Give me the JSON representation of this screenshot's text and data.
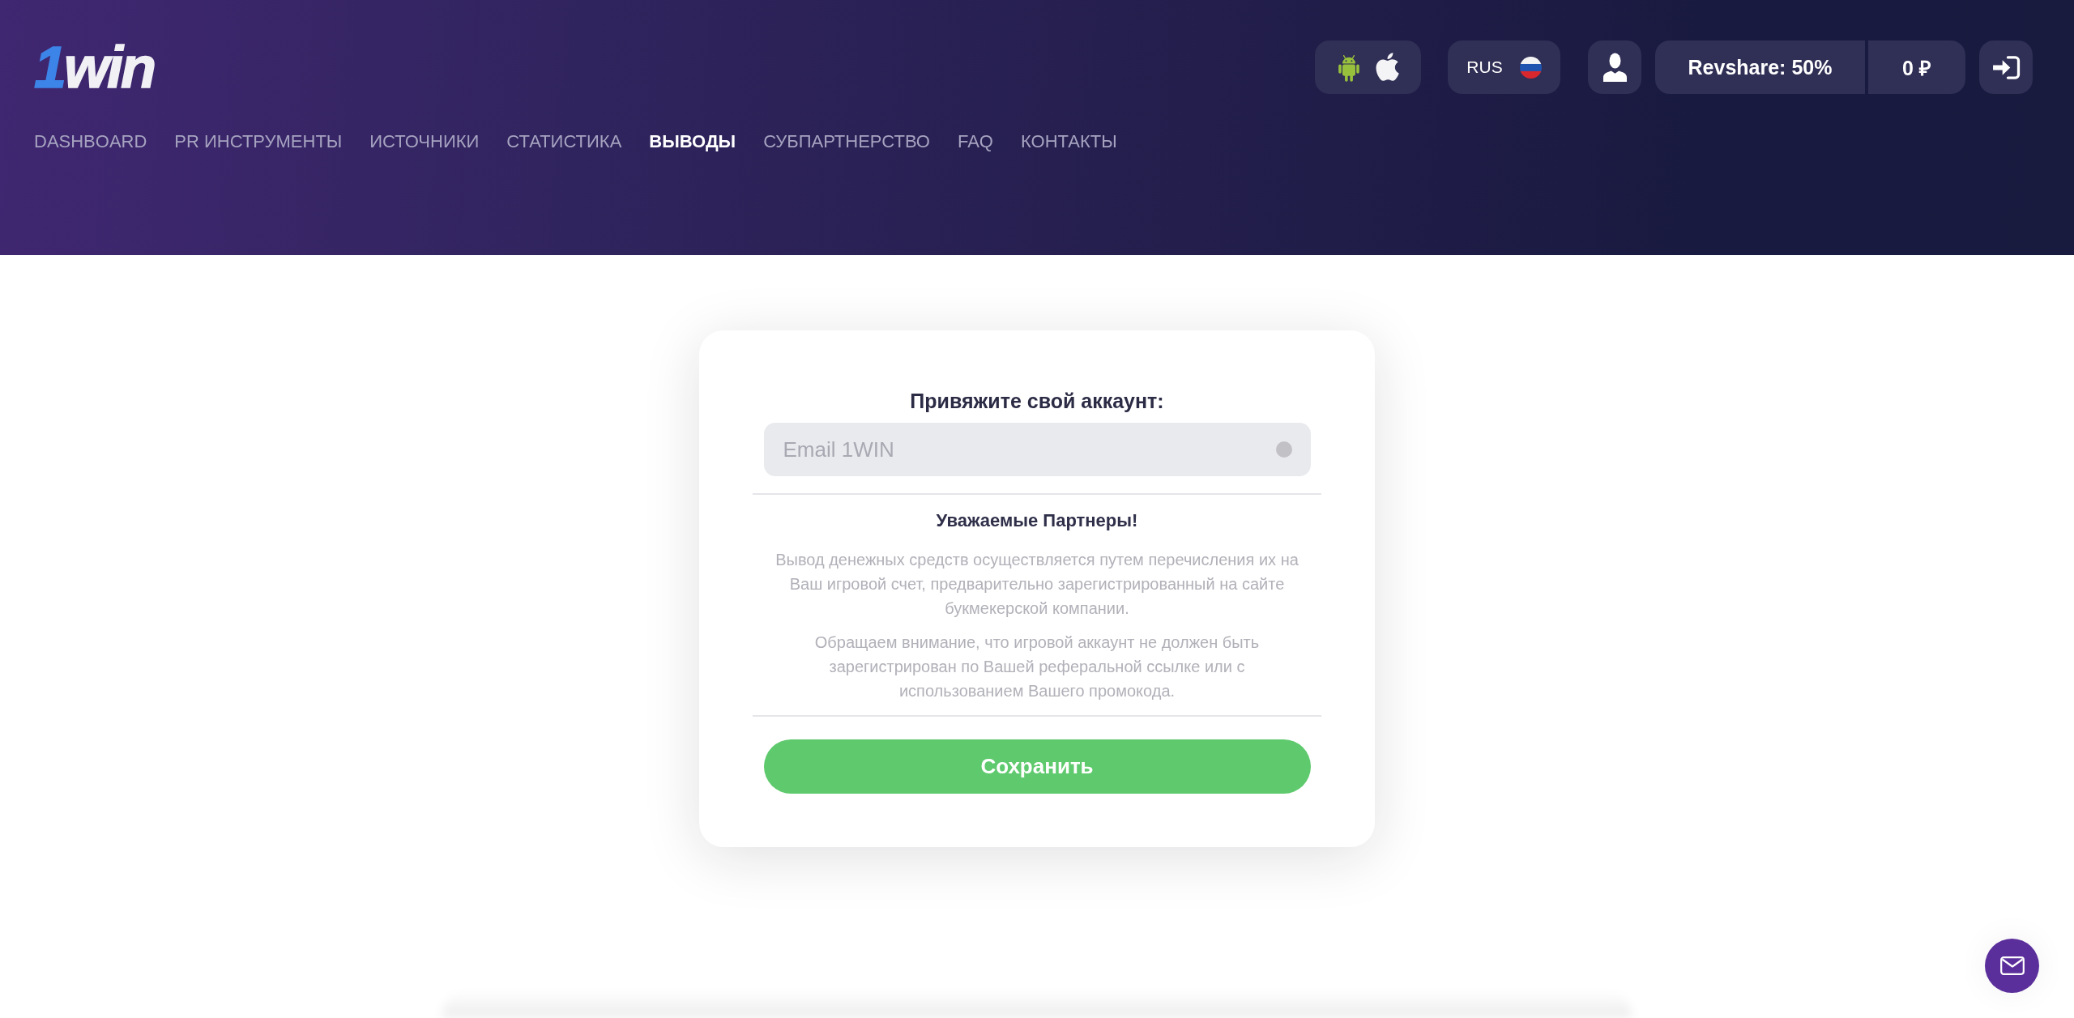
{
  "logo": {
    "digit": "1",
    "word": "win"
  },
  "nav": [
    {
      "label": "DASHBOARD",
      "selected": false
    },
    {
      "label": "PR ИНСТРУМЕНТЫ",
      "selected": false
    },
    {
      "label": "ИСТОЧНИКИ",
      "selected": false
    },
    {
      "label": "СТАТИСТИКА",
      "selected": false
    },
    {
      "label": "ВЫВОДЫ",
      "selected": true
    },
    {
      "label": "СУБПАРТНЕРСТВО",
      "selected": false
    },
    {
      "label": "FAQ",
      "selected": false
    },
    {
      "label": "КОНТАКТЫ",
      "selected": false
    }
  ],
  "language": {
    "code": "RUS"
  },
  "revshare": "Revshare: 50%",
  "balance": "0 ₽",
  "card": {
    "title": "Привяжите свой аккаунт:",
    "email_field": {
      "placeholder": "Email 1WIN"
    },
    "notice_title": "Уважаемые Партнеры!",
    "paragraphs": [
      "Вывод денежных средств осуществляется путем перечисления их на Ваш игровой счет, предварительно зарегистрированный на сайте букмекерской компании.",
      "Обращаем внимание, что игровой аккаунт не должен быть зарегистрирован по Вашей реферальной ссылке или с использованием Вашего промокода."
    ],
    "save_button": "Сохранить"
  }
}
